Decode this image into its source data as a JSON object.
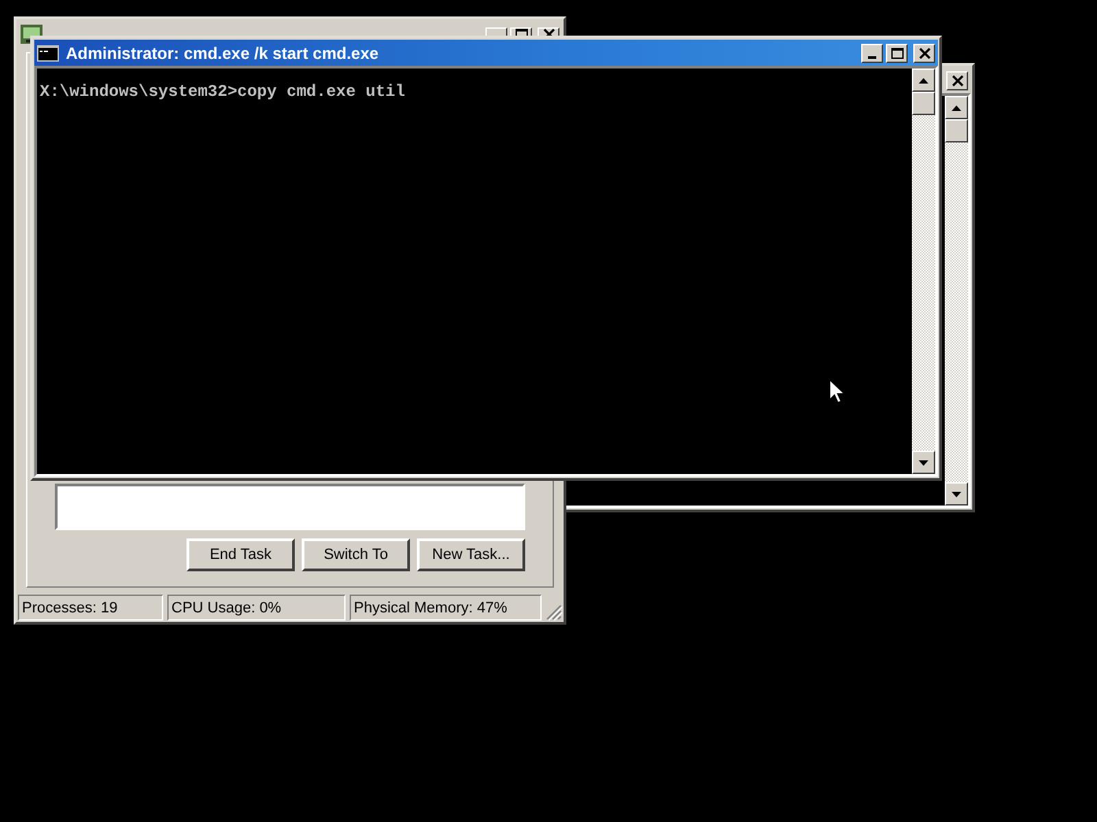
{
  "task_manager": {
    "buttons": [
      "End Task",
      "Switch To",
      "New Task..."
    ],
    "status_bar": [
      "Processes: 19",
      "CPU Usage: 0%",
      "Physical Memory: 47%"
    ]
  },
  "console": {
    "title": "Administrator: cmd.exe /k start cmd.exe",
    "lines": [
      "X:\\windows\\system32>copy cmd.exe util"
    ]
  }
}
